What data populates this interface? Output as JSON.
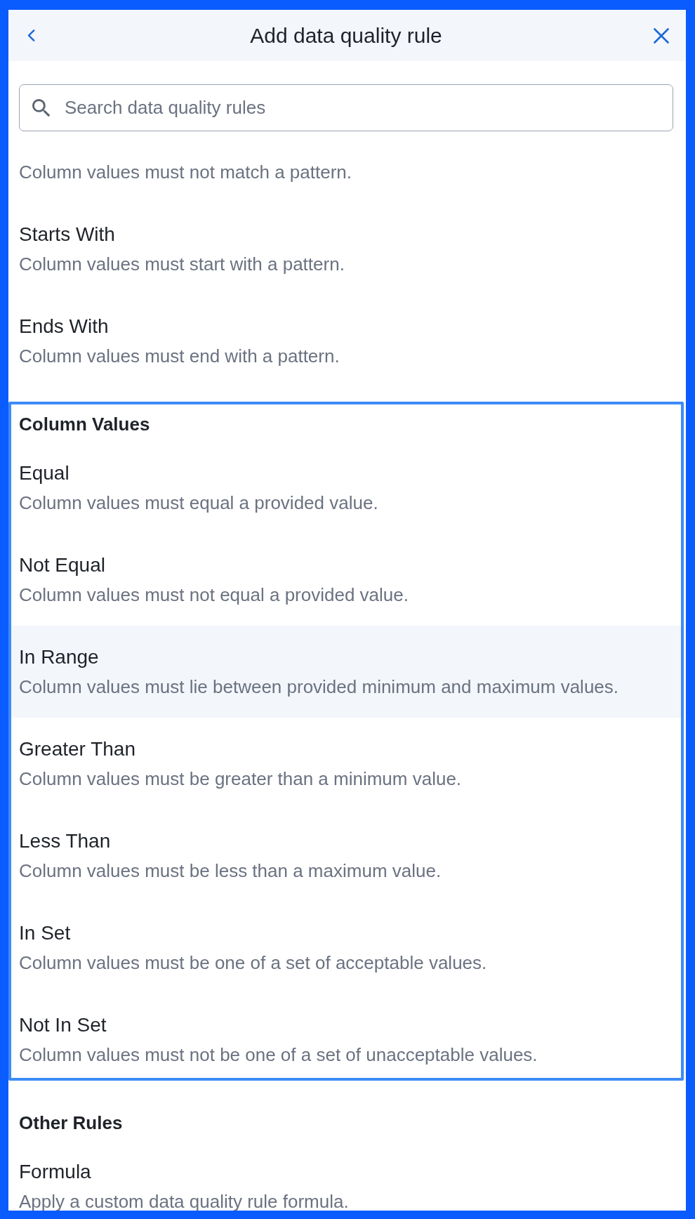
{
  "header": {
    "title": "Add data quality rule"
  },
  "search": {
    "placeholder": "Search data quality rules"
  },
  "groups": [
    {
      "highlighted": false,
      "rules": [
        {
          "description": "Column values must not match a pattern.",
          "selected": false
        },
        {
          "title": "Starts With",
          "description": "Column values must start with a pattern.",
          "selected": false
        },
        {
          "title": "Ends With",
          "description": "Column values must end with a pattern.",
          "selected": false
        }
      ]
    },
    {
      "heading": "Column Values",
      "highlighted": true,
      "rules": [
        {
          "title": "Equal",
          "description": "Column values must equal a provided value.",
          "selected": false
        },
        {
          "title": "Not Equal",
          "description": "Column values must not equal a provided value.",
          "selected": false
        },
        {
          "title": "In Range",
          "description": "Column values must lie between provided minimum and maximum values.",
          "selected": true
        },
        {
          "title": "Greater Than",
          "description": "Column values must be greater than a minimum value.",
          "selected": false
        },
        {
          "title": "Less Than",
          "description": "Column values must be less than a maximum value.",
          "selected": false
        },
        {
          "title": "In Set",
          "description": "Column values must be one of a set of acceptable values.",
          "selected": false
        },
        {
          "title": "Not In Set",
          "description": "Column values must not be one of a set of unacceptable values.",
          "selected": false
        }
      ]
    },
    {
      "heading": "Other Rules",
      "highlighted": false,
      "rules": [
        {
          "title": "Formula",
          "description": "Apply a custom data quality rule formula.",
          "selected": false
        }
      ]
    }
  ]
}
